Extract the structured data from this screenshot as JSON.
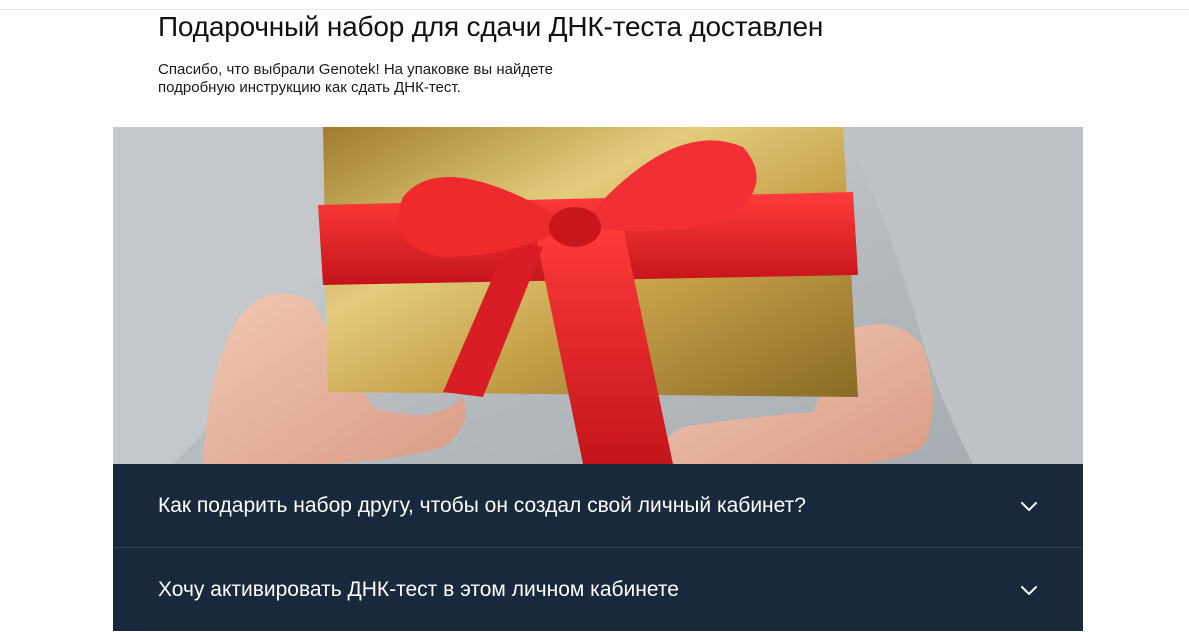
{
  "page": {
    "title": "Подарочный набор для сдачи ДНК-теста доставлен",
    "subtitle": "Спасибо, что выбрали Genotek! На упаковке вы найдете подробную инструкцию как сдать ДНК-тест."
  },
  "hero": {
    "icon": "gift-box-photo",
    "colors": {
      "ribbon": "#e8262a",
      "box_gold": "#c9a64a",
      "sweater": "#b9bec2"
    }
  },
  "accordion": {
    "background": "#17293a",
    "items": [
      {
        "label": "Как подарить набор другу, чтобы он создал свой личный кабинет?",
        "icon": "chevron-down-icon"
      },
      {
        "label": "Хочу активировать ДНК-тест в этом личном кабинете",
        "icon": "chevron-down-icon"
      }
    ]
  }
}
